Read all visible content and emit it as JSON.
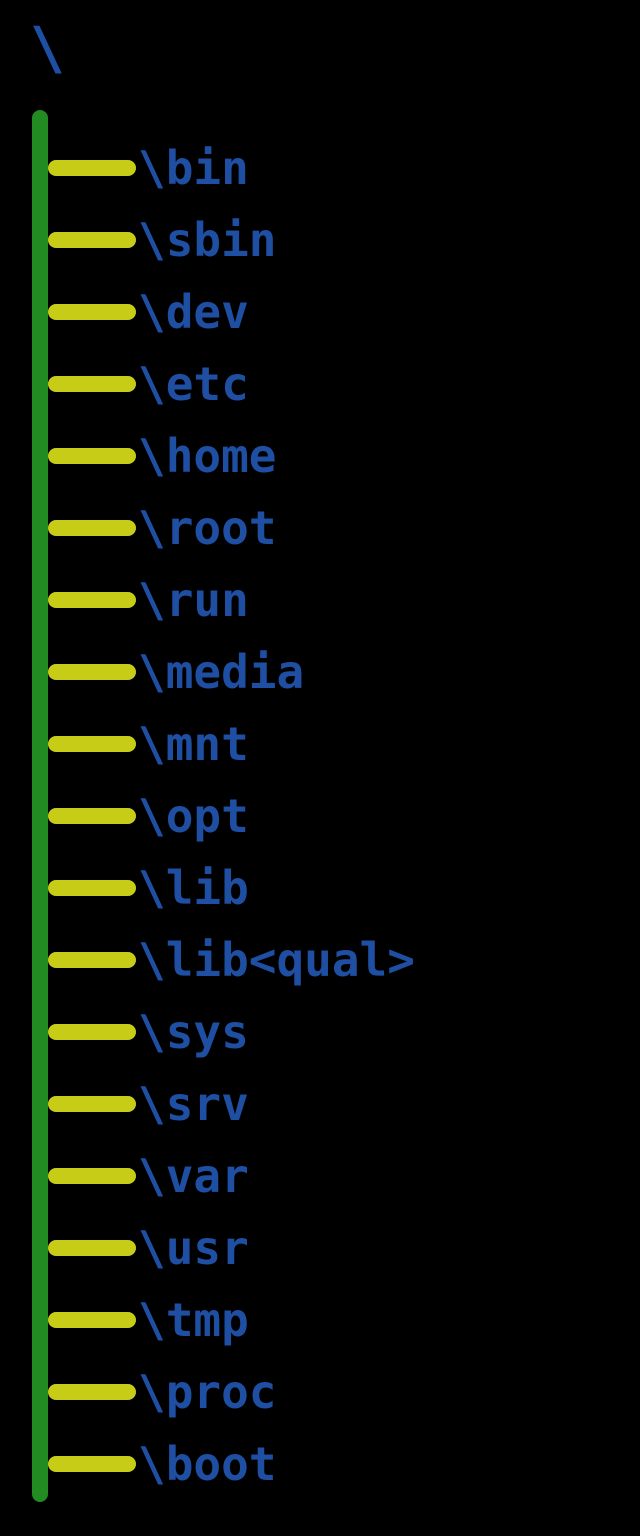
{
  "root": {
    "label": "\\"
  },
  "colors": {
    "background": "#000000",
    "trunk": "#228B22",
    "branch_line": "#C7CC17",
    "text": "#1E4FA3"
  },
  "directories": [
    {
      "label": "\\bin"
    },
    {
      "label": "\\sbin"
    },
    {
      "label": "\\dev"
    },
    {
      "label": "\\etc"
    },
    {
      "label": "\\home"
    },
    {
      "label": "\\root"
    },
    {
      "label": "\\run"
    },
    {
      "label": "\\media"
    },
    {
      "label": "\\mnt"
    },
    {
      "label": "\\opt"
    },
    {
      "label": "\\lib"
    },
    {
      "label": "\\lib<qual>"
    },
    {
      "label": "\\sys"
    },
    {
      "label": "\\srv"
    },
    {
      "label": "\\var"
    },
    {
      "label": "\\usr"
    },
    {
      "label": "\\tmp"
    },
    {
      "label": "\\proc"
    },
    {
      "label": "\\boot"
    }
  ]
}
